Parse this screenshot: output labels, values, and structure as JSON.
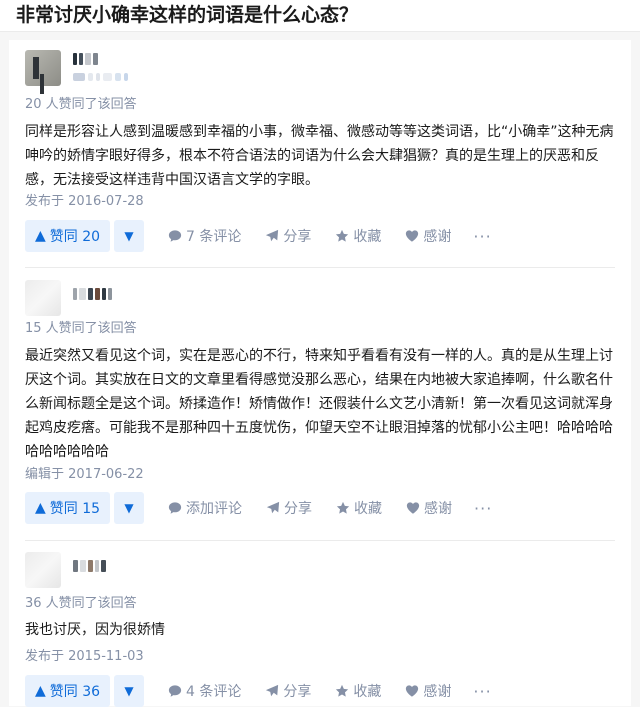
{
  "question": {
    "title": "非常讨厌小确幸这样的词语是什么心态？"
  },
  "answers": [
    {
      "upvoters_text": "20 人赞同了该回答",
      "content": "同样是形容让人感到温暖感到幸福的小事，微幸福、微感动等等这类词语，比“小确幸”这种无病呻吟的娇情字眼好得多，根本不符合语法的词语为什么会大肆猖獗？真的是生理上的厌恶和反感，无法接受这样违背中国汉语言文学的字眼。",
      "date": "发布于 2016-07-28",
      "vote_up": "赞同 20",
      "comments": "7 条评论",
      "share": "分享",
      "collect": "收藏",
      "thanks": "感谢",
      "more": "···"
    },
    {
      "upvoters_text": "15 人赞同了该回答",
      "content": "最近突然又看见这个词，实在是恶心的不行，特来知乎看看有没有一样的人。真的是从生理上讨厌这个词。其实放在日文的文章里看得感觉没那么恶心，结果在内地被大家追捧啊，什么歌名什么新闻标题全是这个词。矫揉造作！矫情做作！还假装什么文艺小清新！第一次看见这词就浑身起鸡皮疙瘩。可能我不是那种四十五度忧伤，仰望天空不让眼泪掉落的忧郁小公主吧！哈哈哈哈哈哈哈哈哈哈",
      "date": "编辑于 2017-06-22",
      "vote_up": "赞同 15",
      "comments": "添加评论",
      "share": "分享",
      "collect": "收藏",
      "thanks": "感谢",
      "more": "···"
    },
    {
      "upvoters_text": "36 人赞同了该回答",
      "content": "我也讨厌，因为很娇情",
      "date": "发布于 2015-11-03",
      "vote_up": "赞同 36",
      "comments": "4 条评论",
      "share": "分享",
      "collect": "收藏",
      "thanks": "感谢",
      "more": "···"
    }
  ],
  "icons": {
    "vote_up": "triangle-up-icon",
    "vote_down": "triangle-down-icon",
    "comment": "comment-bubble-icon",
    "share": "paper-plane-icon",
    "collect": "star-icon",
    "thanks": "heart-icon"
  },
  "colors": {
    "accent": "#0f6bd8",
    "accent_bg": "#e8f1fd",
    "meta": "#8590a6",
    "text": "#1a1a1a"
  }
}
